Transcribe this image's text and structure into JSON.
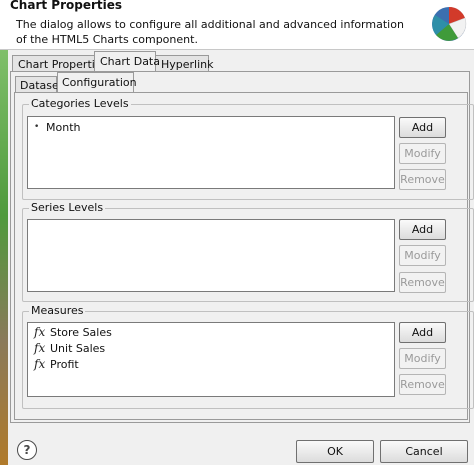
{
  "dialog": {
    "title": "Chart Properties",
    "description": "The dialog allows to configure all additional and advanced information of the HTML5 Charts component."
  },
  "tabs": [
    {
      "label": "Chart Properties",
      "active": false
    },
    {
      "label": "Chart Data",
      "active": true
    },
    {
      "label": "Hyperlink",
      "active": false
    }
  ],
  "subtabs": [
    {
      "label": "Dataset",
      "active": false
    },
    {
      "label": "Configuration",
      "active": true
    }
  ],
  "categories": {
    "label": "Categories Levels",
    "items": [
      "Month"
    ],
    "add": "Add",
    "modify": "Modify",
    "remove": "Remove"
  },
  "series": {
    "label": "Series Levels",
    "items": [],
    "add": "Add",
    "modify": "Modify",
    "remove": "Remove"
  },
  "measures": {
    "label": "Measures",
    "items": [
      "Store Sales",
      "Unit Sales",
      "Profit"
    ],
    "add": "Add",
    "modify": "Modify",
    "remove": "Remove"
  },
  "footer": {
    "help": "?",
    "ok": "OK",
    "cancel": "Cancel"
  },
  "icons": {
    "header": "pie-chart-icon",
    "category_item": "bullet-icon",
    "measure_item": "fx-icon"
  }
}
